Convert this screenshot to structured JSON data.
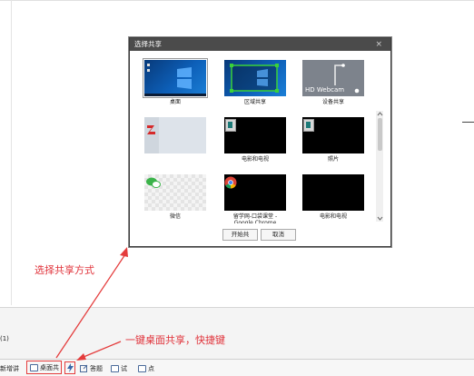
{
  "dialog": {
    "title": "选择共享",
    "close": "×",
    "tiles": [
      {
        "caption": "桌面"
      },
      {
        "caption": "区域共享"
      },
      {
        "caption": "设备共享",
        "overlay": "HD Webcam"
      },
      {
        "caption": ""
      },
      {
        "caption": "电影和电视"
      },
      {
        "caption": "照片"
      },
      {
        "caption": "微信"
      },
      {
        "caption": "留学网-口袋课堂 -",
        "caption2": "Google Chrome"
      },
      {
        "caption": "电影和电视"
      }
    ],
    "start_button": "开始共",
    "cancel_button": "取消"
  },
  "bottom": {
    "count_label": "(1)",
    "toolbar": {
      "item1": "新增讲",
      "item2": "桌面共",
      "item4": "答题",
      "item5": "试",
      "item6": "点"
    }
  },
  "annotations": {
    "choose_share_mode": "选择共享方式",
    "one_key_share": "一键桌面共享，快捷键"
  },
  "colors": {
    "accent": "#e43c3c",
    "title_bar": "#4b4b4b",
    "windows_blue": "#0d5fb8"
  }
}
